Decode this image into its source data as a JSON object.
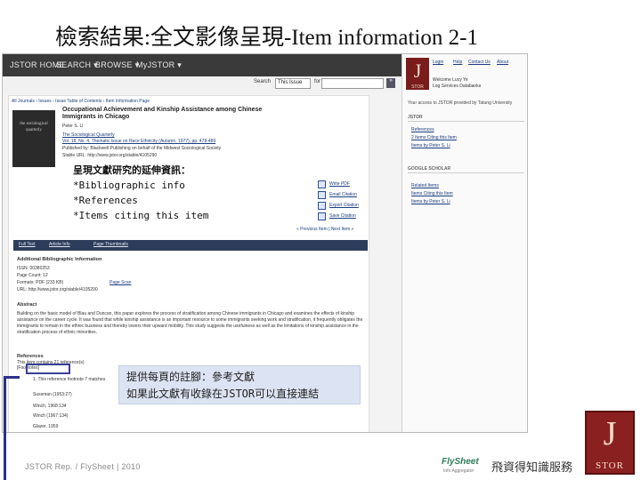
{
  "slide": {
    "title": "檢索結果:全文影像呈現-Item information 2-1",
    "footer": "JSTOR Rep. / FlySheet | 2010"
  },
  "nav": {
    "items": [
      "JSTOR HOME",
      "SEARCH ▾",
      "BROWSE ▾",
      "MyJSTOR ▾"
    ]
  },
  "search": {
    "label": "Search",
    "scope": "This Issue",
    "for_label": "for",
    "go": "»"
  },
  "right_panel": {
    "toplinks": [
      "Login",
      "Help",
      "Contact Us",
      "About"
    ],
    "welcome": "Welcome Lucy Ye",
    "welcome_sub": "Log Services Databanks",
    "access": "Your access to JSTOR provided by Tatung University",
    "jstor_head": "JSTOR",
    "jstor_links": [
      "References",
      "2 Items Citing this Item",
      "Items by Peter S. Li"
    ],
    "scholar_head": "GOOGLE SCHOLAR",
    "scholar_links": [
      "Related Items",
      "Items Citing this Item",
      "Items by Peter S. Li"
    ]
  },
  "article": {
    "breadcrumb": "All Journals › Issues › Issue Table of Contents › Item Information Page",
    "cover_text": "the sociological quarterly",
    "title": "Occupational Achievement and Kinship Assistance among Chinese Immigrants in Chicago",
    "author": "Peter S. Li",
    "journal": "The Sociological Quarterly",
    "volume": "Vol. 18, No. 4, Thematic Issue on Race Ethnicity (Autumn, 1977), pp. 478-489",
    "publisher": "Published by: Blackwell Publishing on behalf of the Midwest Sociological Society",
    "stable_url": "Stable URL: http://www.jstor.org/stable/4105290"
  },
  "annotation_top": {
    "lines": [
      "呈現文獻研究的延伸資訊：",
      "*Bibliographic info",
      "*References",
      "*Items citing this item"
    ]
  },
  "tools": [
    "Write PDF",
    "Email Citation",
    "Export Citation",
    "Save Citation"
  ],
  "prev_next": "« Previous Item | Next Item »",
  "tabs": [
    "Full Text",
    "Article Info",
    "Page Thumbnails"
  ],
  "additional": {
    "heading": "Additional Bibliographic Information",
    "issn": "ISSN: 00380253",
    "page_count": "Page Count: 12",
    "formats": "Formats: PDF (233 KB)",
    "pdf_link": "Page Scan",
    "url": "URL: http://www.jstor.org/stable/4105290"
  },
  "abstract": {
    "heading": "Abstract",
    "text": "Building on the basic model of Blau and Duncan, this paper explores the process of stratification among Chinese immigrants in Chicago and examines the effects of kinship assistance on the career cycle. It was found that while kinship assistance is an important resource to some immigrants seeking work and stratification, it frequently obligates the immigrants to remain in the ethnic business and thereby lowers their upward mobility. This study suggests the usefulness as well as the limitations of kinship assistance in the stratification process of ethnic minorities."
  },
  "references": {
    "heading": "References",
    "note": "This item contains 21 reference(s)",
    "footnotes_label": "[Footnotes]",
    "first": "1. This reference footnote 7 matches",
    "items": [
      "Sussman (1953:27)",
      "Winch, 1968:134",
      "Winch (1967:134)",
      "Glazer, 1959"
    ]
  },
  "annotation_bottom": {
    "lines": [
      "提供每頁的註腳：參考文獻",
      "如果此文獻有收錄在JSTOR可以直接連結"
    ]
  },
  "branding": {
    "flysheet": "FlySheet",
    "flysheet_sub": "Info Aggregator",
    "flysheet_cn": "飛資得知識服務",
    "logo_letter": "J",
    "logo_name": "STOR"
  }
}
